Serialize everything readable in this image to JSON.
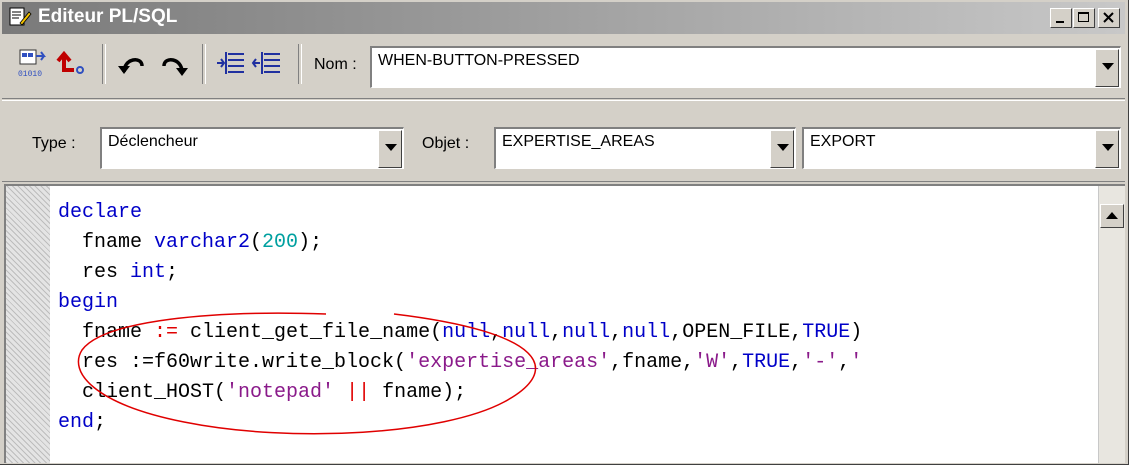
{
  "window": {
    "title": "Editeur PL/SQL"
  },
  "toolbar": {
    "name_label": "Nom :",
    "name_value": "WHEN-BUTTON-PRESSED",
    "icons": [
      "compile-icon",
      "back-icon",
      "undo-icon",
      "redo-icon",
      "indent-icon",
      "outdent-icon"
    ]
  },
  "filters": {
    "type_label": "Type :",
    "type_value": "Déclencheur",
    "object_label": "Objet :",
    "object_value": "EXPERTISE_AREAS",
    "item_value": "EXPORT"
  },
  "code": {
    "lines": [
      [
        {
          "t": "declare",
          "c": "kw"
        }
      ],
      [
        {
          "t": "  fname ",
          "c": ""
        },
        {
          "t": "varchar2",
          "c": "kw"
        },
        {
          "t": "(",
          "c": ""
        },
        {
          "t": "200",
          "c": "num"
        },
        {
          "t": ");",
          "c": ""
        }
      ],
      [
        {
          "t": "  res ",
          "c": ""
        },
        {
          "t": "int",
          "c": "kw"
        },
        {
          "t": ";",
          "c": ""
        }
      ],
      [
        {
          "t": "begin",
          "c": "kw"
        }
      ],
      [
        {
          "t": "  fname ",
          "c": ""
        },
        {
          "t": ":=",
          "c": "op"
        },
        {
          "t": " client_get_file_name(",
          "c": ""
        },
        {
          "t": "null",
          "c": "kw"
        },
        {
          "t": ",",
          "c": ""
        },
        {
          "t": "null",
          "c": "kw"
        },
        {
          "t": ",",
          "c": ""
        },
        {
          "t": "null",
          "c": "kw"
        },
        {
          "t": ",",
          "c": ""
        },
        {
          "t": "null",
          "c": "kw"
        },
        {
          "t": ",OPEN_FILE,",
          "c": ""
        },
        {
          "t": "TRUE",
          "c": "kw"
        },
        {
          "t": ")",
          "c": ""
        }
      ],
      [
        {
          "t": "  res :=f60write.write_block(",
          "c": ""
        },
        {
          "t": "'expertise_areas'",
          "c": "str"
        },
        {
          "t": ",fname,",
          "c": ""
        },
        {
          "t": "'W'",
          "c": "str"
        },
        {
          "t": ",",
          "c": ""
        },
        {
          "t": "TRUE",
          "c": "kw"
        },
        {
          "t": ",",
          "c": ""
        },
        {
          "t": "'-'",
          "c": "str"
        },
        {
          "t": ",",
          "c": ""
        },
        {
          "t": "'",
          "c": "str"
        }
      ],
      [
        {
          "t": "  client_HOST(",
          "c": ""
        },
        {
          "t": "'notepad'",
          "c": "str"
        },
        {
          "t": " ",
          "c": ""
        },
        {
          "t": "||",
          "c": "op"
        },
        {
          "t": " fname);",
          "c": ""
        }
      ],
      [
        {
          "t": "end",
          "c": "kw"
        },
        {
          "t": ";",
          "c": ""
        }
      ]
    ]
  },
  "colors": {
    "keyword": "#0000c8",
    "number": "#00a0a0",
    "string": "#8a1a8a",
    "operator": "#e00000",
    "annotation": "#e00000"
  }
}
